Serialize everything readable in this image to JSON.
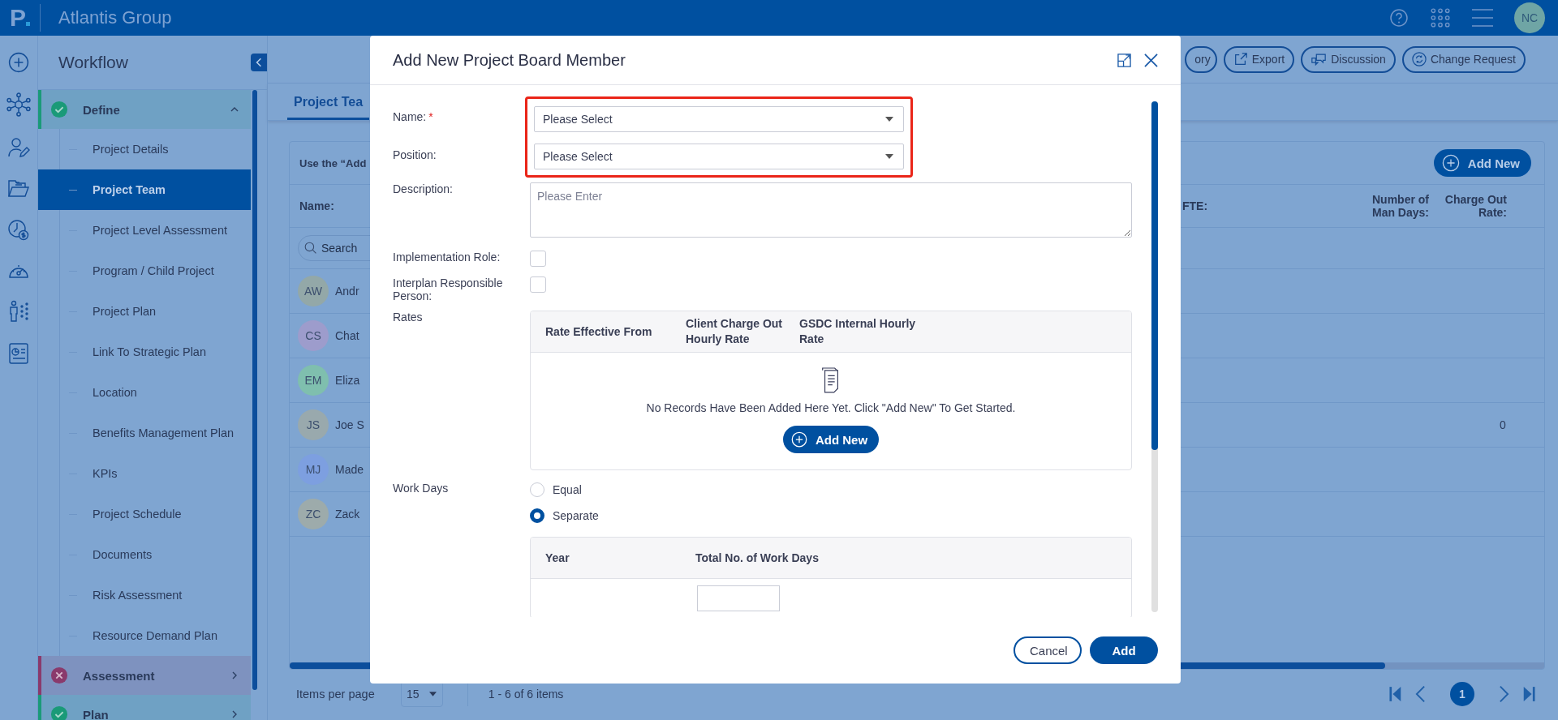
{
  "app": {
    "logo": "P",
    "title": "Atlantis Group",
    "user_initials": "NC"
  },
  "workflow": {
    "title": "Workflow",
    "stages": [
      {
        "label": "Define",
        "kind": "done",
        "expanded": true,
        "children": [
          {
            "label": "Project Details",
            "selected": false
          },
          {
            "label": "Project Team",
            "selected": true
          },
          {
            "label": "Project Level Assessment",
            "selected": false
          },
          {
            "label": "Program / Child Project",
            "selected": false
          },
          {
            "label": "Project Plan",
            "selected": false
          },
          {
            "label": "Link To Strategic Plan",
            "selected": false
          },
          {
            "label": "Location",
            "selected": false
          },
          {
            "label": "Benefits Management Plan",
            "selected": false
          },
          {
            "label": "KPIs",
            "selected": false
          },
          {
            "label": "Project Schedule",
            "selected": false
          },
          {
            "label": "Documents",
            "selected": false
          },
          {
            "label": "Risk Assessment",
            "selected": false
          },
          {
            "label": "Resource Demand Plan",
            "selected": false
          }
        ]
      },
      {
        "label": "Assessment",
        "kind": "failed",
        "expanded": false
      },
      {
        "label": "Plan",
        "kind": "done",
        "expanded": false
      }
    ]
  },
  "toolbar": [
    "ory",
    "Export",
    "Discussion",
    "Change Request"
  ],
  "tabs": [
    {
      "label": "Project Tea",
      "selected": true
    }
  ],
  "card": {
    "hint": "Use the “Add",
    "add_button": "Add New",
    "columns": [
      "Name:",
      "FTE:",
      "Number of Man Days:",
      "Charge Out Rate:"
    ],
    "search_placeholder": "Search",
    "rows": [
      {
        "initials": "AW",
        "name": "Andr",
        "color": "#93a8a8"
      },
      {
        "initials": "CS",
        "name": "Chat",
        "color": "#9d9ccc"
      },
      {
        "initials": "EM",
        "name": "Eliza",
        "color": "#7fbfae"
      },
      {
        "initials": "JS",
        "name": "Joe S",
        "color": "#99a9ad",
        "charge_out_rate": "0"
      },
      {
        "initials": "MJ",
        "name": "Made",
        "color": "#7d9fe0"
      },
      {
        "initials": "ZC",
        "name": "Zack",
        "color": "#9dabab"
      }
    ]
  },
  "pager": {
    "label": "Items per page",
    "page_size": "15",
    "range": "1 - 6 of 6 items",
    "pages": [
      {
        "label": "1",
        "selected": true
      }
    ]
  },
  "modal": {
    "title": "Add New Project Board Member",
    "required_mark": "*",
    "highlighted_fields": [
      {
        "label": "Name:",
        "required": true,
        "placeholder": "Please Select"
      },
      {
        "label": "Position:",
        "required": false,
        "placeholder": "Please Select"
      }
    ],
    "fields": [
      {
        "kind": "textarea",
        "label": "Description:",
        "placeholder": "Please Enter"
      },
      {
        "kind": "checkbox",
        "label": "Implementation Role:",
        "checked": false
      },
      {
        "kind": "checkbox",
        "label": "Interplan Responsible Person:",
        "checked": false
      },
      {
        "kind": "table",
        "label": "Rates",
        "columns": [
          "Rate Effective From",
          "Client Charge Out Hourly Rate",
          "GSDC Internal Hourly Rate"
        ],
        "empty_text": "No Records Have Been Added Here Yet. Click \"Add New\" To Get Started.",
        "add_button": "Add New"
      },
      {
        "kind": "radio",
        "label": "Work Days",
        "options": [
          {
            "label": "Equal",
            "selected": false
          },
          {
            "label": "Separate",
            "selected": true
          }
        ],
        "columns": [
          "Year",
          "Total No. of Work Days"
        ]
      }
    ],
    "buttons": [
      {
        "label": "Cancel",
        "kind": "secondary"
      },
      {
        "label": "Add",
        "kind": "primary"
      }
    ]
  }
}
